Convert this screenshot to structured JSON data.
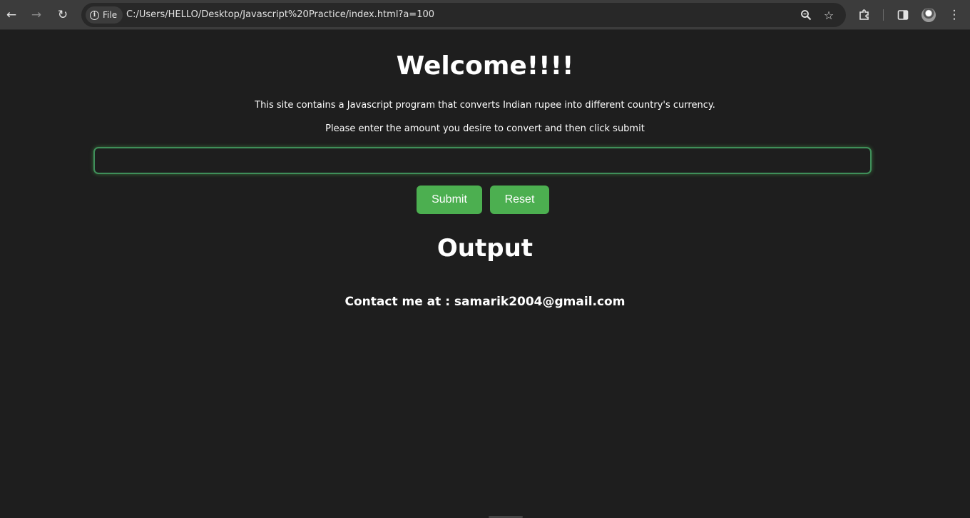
{
  "browser": {
    "chip_label": "File",
    "url": "C:/Users/HELLO/Desktop/Javascript%20Practice/index.html?a=100",
    "icons": [
      "back-icon",
      "forward-icon",
      "reload-icon",
      "info-icon",
      "zoom-icon",
      "bookmark-star-icon",
      "extensions-icon",
      "side-panel-icon",
      "profile-avatar",
      "menu-icon"
    ]
  },
  "page": {
    "title": "Welcome!!!!",
    "description": "This site contains a Javascript program that converts Indian rupee into different country's currency.",
    "instruction": "Please enter the amount you desire to convert and then click submit",
    "amount_value": "",
    "submit_label": "Submit",
    "reset_label": "Reset",
    "output_heading": "Output",
    "contact": "Contact me at : samarik2004@gmail.com"
  },
  "colors": {
    "background": "#1e1e1e",
    "button": "#4caf50",
    "input_border": "#3f8f5a",
    "text": "#ffffff"
  }
}
